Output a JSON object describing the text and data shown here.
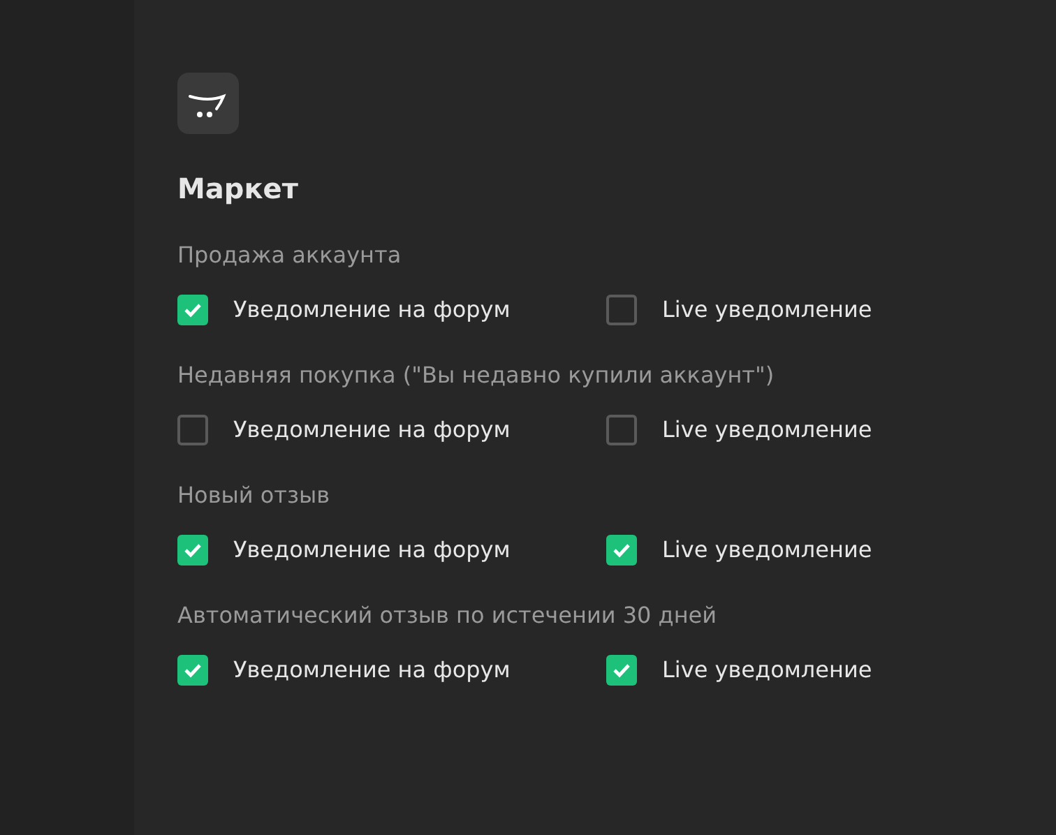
{
  "section": {
    "title": "Маркет"
  },
  "groups": [
    {
      "label": "Продажа аккаунта",
      "options": [
        {
          "label": "Уведомление на форум",
          "checked": true
        },
        {
          "label": "Live уведомление",
          "checked": false
        }
      ]
    },
    {
      "label": "Недавняя покупка (\"Вы недавно купили аккаунт\")",
      "options": [
        {
          "label": "Уведомление на форум",
          "checked": false
        },
        {
          "label": "Live уведомление",
          "checked": false
        }
      ]
    },
    {
      "label": "Новый отзыв",
      "options": [
        {
          "label": "Уведомление на форум",
          "checked": true
        },
        {
          "label": "Live уведомление",
          "checked": true
        }
      ]
    },
    {
      "label": "Автоматический отзыв по истечении 30 дней",
      "options": [
        {
          "label": "Уведомление на форум",
          "checked": true
        },
        {
          "label": "Live уведомление",
          "checked": true
        }
      ]
    }
  ]
}
